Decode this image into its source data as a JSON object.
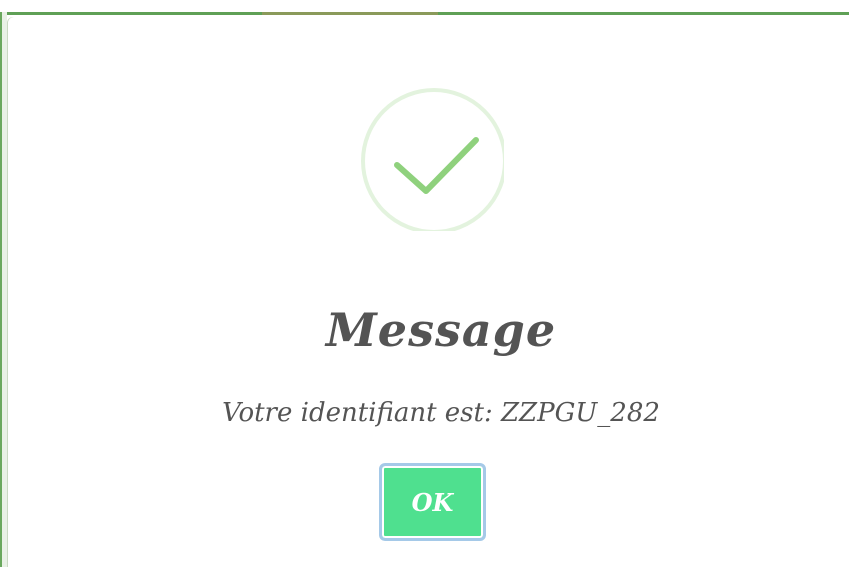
{
  "dialog": {
    "icon": "success-check-icon",
    "title": "Message",
    "text": "Votre identifiant est: ZZPGU_282",
    "confirm_label": "OK"
  },
  "colors": {
    "success_green": "#8fd17d",
    "success_ring": "#e3f3de",
    "confirm_button": "#4fe08f",
    "text": "#545454"
  }
}
